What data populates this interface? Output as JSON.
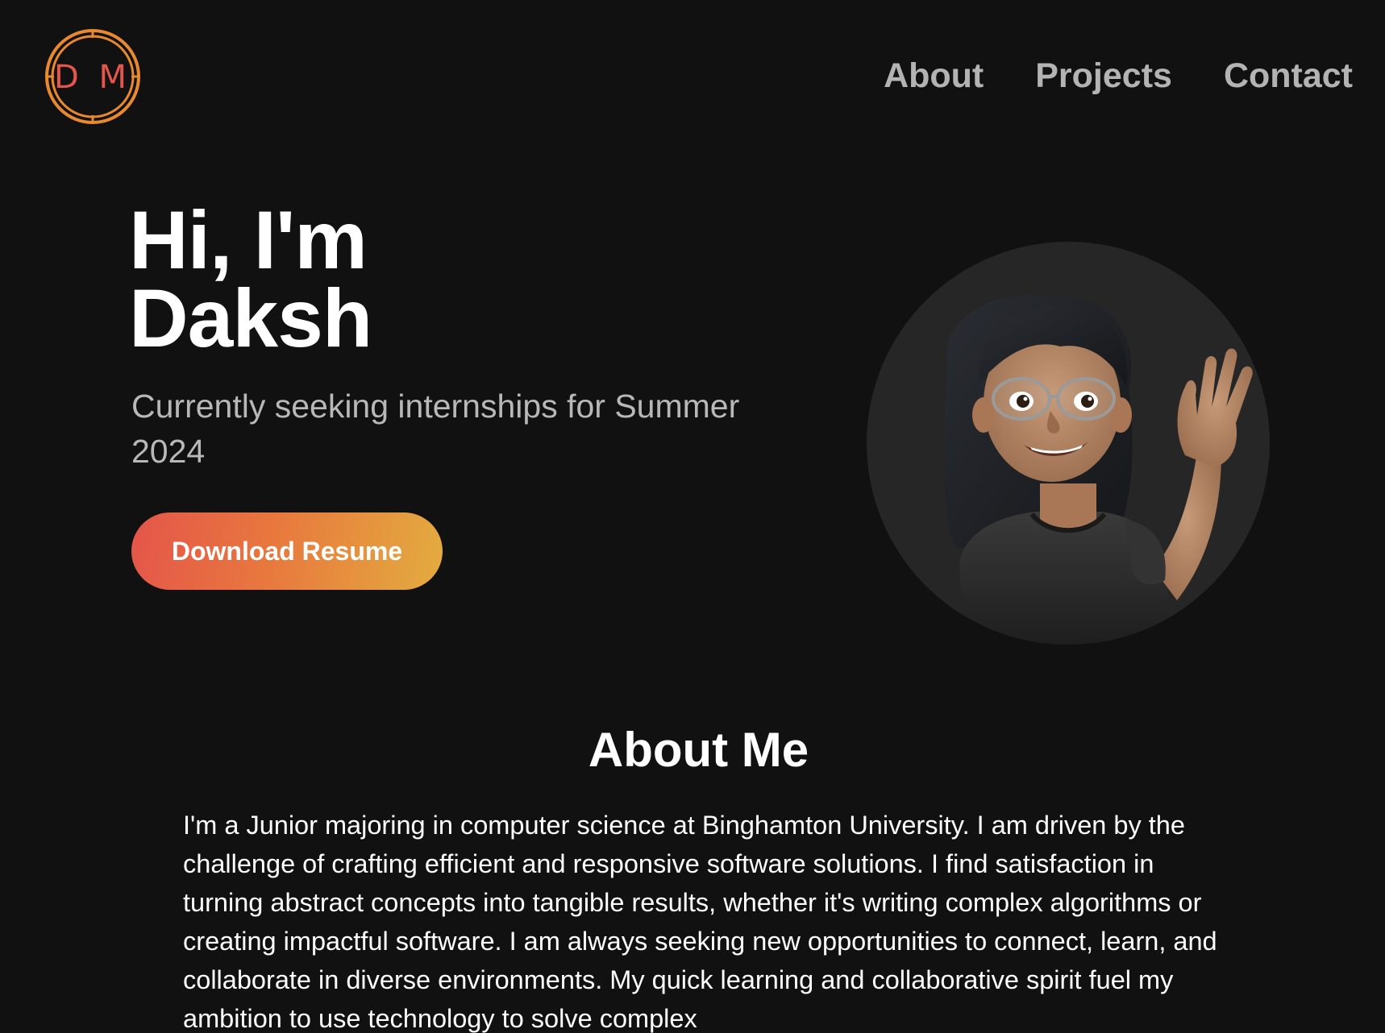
{
  "logo": {
    "text": "D M",
    "icon": "dm-monogram-logo"
  },
  "nav": {
    "items": [
      {
        "label": "About"
      },
      {
        "label": "Projects"
      },
      {
        "label": "Contact"
      }
    ]
  },
  "hero": {
    "greeting_line1": "Hi, I'm",
    "greeting_line2": "Daksh",
    "subtitle": "Currently seeking internships for Summer 2024",
    "button_label": "Download Resume",
    "avatar_icon": "memoji-waving-avatar"
  },
  "about": {
    "title": "About Me",
    "body": "I'm a Junior majoring in computer science at Binghamton University. I am driven by the challenge of crafting efficient and responsive software solutions. I find satisfaction in turning abstract concepts into tangible results, whether it's writing complex algorithms or creating impactful software. I am always seeking new opportunities to connect, learn, and collaborate in diverse environments. My quick learning and collaborative spirit fuel my ambition to use technology to solve complex"
  },
  "colors": {
    "background": "#111111",
    "nav_text": "#b3b3b3",
    "subtitle_text": "#b8b8b8",
    "logo_orange": "#e8892f",
    "logo_letters": "#e4554a",
    "button_gradient_start": "#e4554a",
    "button_gradient_end": "#e3ac3f"
  }
}
